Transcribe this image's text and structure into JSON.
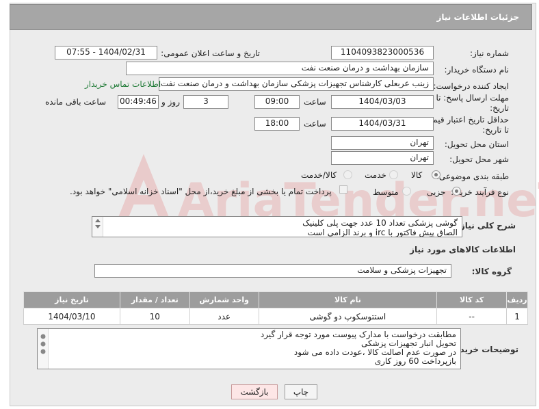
{
  "header": {
    "title": "جزئیات اطلاعات نیاز"
  },
  "labels": {
    "need_number": "شماره نیاز:",
    "announce_datetime": "تاریخ و ساعت اعلان عمومی:",
    "buyer_org": "نام دستگاه خریدار:",
    "requester": "ایجاد کننده درخواست:",
    "send_deadline_1": "مهلت ارسال پاسخ: تا",
    "send_deadline_2": "تاریخ:",
    "price_validity_1": "حداقل تاریخ اعتبار قیمت:",
    "price_validity_2": "تا تاریخ:",
    "delivery_province": "استان محل تحویل:",
    "delivery_city": "شهر محل تحویل:",
    "category": "طبقه بندی موضوعی:",
    "process_type": "نوع فرآیند خرید :",
    "need_description": "شرح کلی نیاز:",
    "goods_info": "اطلاعات کالاهای مورد نیاز",
    "goods_group": "گروه کالا:",
    "buyer_notes": "توضیحات خریدار:",
    "time": "ساعت",
    "days_and": "روز و",
    "time_remaining": "ساعت باقی مانده"
  },
  "values": {
    "need_number": "1104093823000536",
    "announce_datetime": "1404/02/31 - 07:55",
    "buyer_org": "سازمان بهداشت و درمان صنعت نفت",
    "requester": "زینب عربعلی کارشناس تجهیزات پزشکی سازمان بهداشت و درمان صنعت نفت",
    "buyer_contact_link": "اطلاعات تماس خریدار",
    "send_deadline_date": "1404/03/03",
    "send_deadline_time": "09:00",
    "days": "3",
    "remaining": "00:49:46",
    "price_validity_date": "1404/03/31",
    "price_validity_time": "18:00",
    "delivery_province": "تهران",
    "delivery_city": "تهران",
    "goods_group": "تجهیزات پزشکی و سلامت"
  },
  "category_options": [
    {
      "label": "کالا",
      "selected": true
    },
    {
      "label": "خدمت",
      "selected": false
    },
    {
      "label": "کالا/خدمت",
      "selected": false
    }
  ],
  "process_options": [
    {
      "label": "جزیی",
      "selected": true
    },
    {
      "label": "متوسط",
      "selected": false
    }
  ],
  "payment_note": "پرداخت تمام یا بخشی از مبلغ خرید،از محل \"اسناد خزانه اسلامی\" خواهد بود.",
  "description_lines": [
    "گوشی پزشکی  تعداد 10 عدد جهت پلی کلینیک",
    "الصاق پیش فاکتور با irc  و برند الزامی است"
  ],
  "table": {
    "columns": [
      "ردیف",
      "کد کالا",
      "نام کالا",
      "واحد شمارش",
      "تعداد / مقدار",
      "تاریخ نیاز"
    ],
    "rows": [
      [
        "1",
        "--",
        "استتوسکوپ دو گوشی",
        "عدد",
        "10",
        "1404/03/10"
      ]
    ]
  },
  "buyer_notes_lines": [
    "مطابقت درخواست با مدارک پیوست مورد توجه قرار گیرد",
    "تحویل انبار تجهیزات پزشکی",
    "در صورت عدم اصالت کالا ،عودت داده می شود",
    "بازپرداخت 60 روز کاری"
  ],
  "buttons": {
    "print": "چاپ",
    "back": "بازگشت"
  },
  "watermark": {
    "text": "AriaTender.neT"
  },
  "colors": {
    "header_bg": "#a6a6a6",
    "link": "#1f7a36",
    "back_button_bg": "#fde6e6",
    "watermark": "#e8c0c0"
  }
}
